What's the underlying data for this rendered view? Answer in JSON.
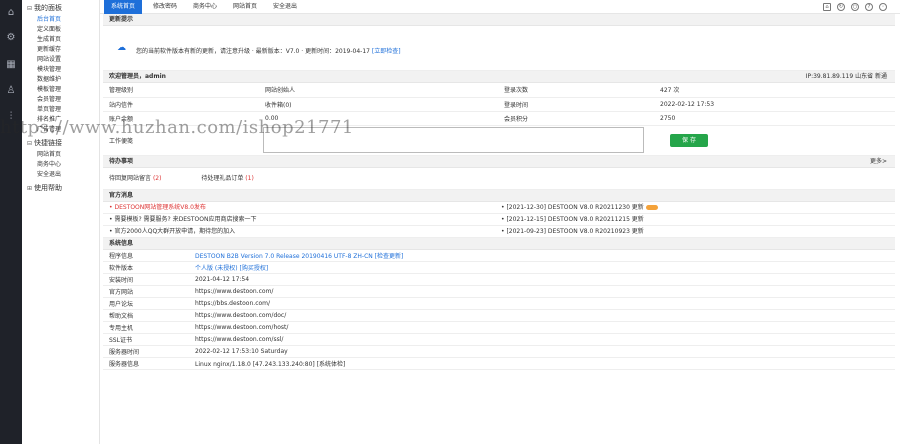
{
  "iconbar": [
    "home-icon",
    "gear-icon",
    "grid-icon",
    "user-icon",
    "chart-icon"
  ],
  "sidebar": {
    "groups": [
      {
        "label": "我的面板",
        "items": [
          "后台首页",
          "定义面板",
          "生成首页",
          "更新缓存",
          "网站设置",
          "模块管理",
          "数据维护",
          "模板管理",
          "会员管理",
          "单页管理",
          "排名推广",
          "广告管理"
        ]
      },
      {
        "label": "快捷链接",
        "items": [
          "网站首页",
          "商务中心",
          "安全退出"
        ]
      },
      {
        "label": "使用帮助",
        "items": []
      }
    ],
    "active_item": "后台首页"
  },
  "topbar": {
    "tabs": [
      "系统首页",
      "修改密码",
      "商务中心",
      "网站首页",
      "安全退出"
    ],
    "tools": [
      "home-icon",
      "refresh-icon",
      "search-icon",
      "help-icon",
      "user-icon"
    ]
  },
  "update": {
    "title": "更新提示",
    "text": "您的当前软件版本有新的更新，请注意升级 · 最新版本：V7.0 · 更新时间：2019-04-17",
    "link": "[立即检查]"
  },
  "welcome": {
    "title": "欢迎管理员，admin",
    "ip": "IP:39.81.89.119 山东省 新通",
    "rows": [
      [
        "管理级别",
        "网站创始人",
        "登录次数",
        "427 次"
      ],
      [
        "站内信件",
        "收件箱(0)",
        "登录时间",
        "2022-02-12 17:53"
      ],
      [
        "账户余额",
        "0.00",
        "会员积分",
        "2750"
      ]
    ],
    "work_label": "工作便笺",
    "save": "保 存"
  },
  "todo": {
    "title": "待办事项",
    "more": "更多>",
    "items": [
      {
        "label": "待回复网站留言",
        "count": "(2)"
      },
      {
        "label": "待处理礼品订单",
        "count": "(1)"
      }
    ]
  },
  "official": {
    "title": "官方消息",
    "left": [
      "• DESTOON网站管理系统V8.0发布",
      "• 需要模板? 需要服务? 来DESTOON应用商店搜索一下",
      "• 官方2000人QQ大群开放申请，期待您的加入"
    ],
    "right": [
      "• [2021-12-30]  DESTOON V8.0 R20211230 更新",
      "• [2021-12-15]  DESTOON V8.0 R20211215 更新",
      "• [2021-09-23]  DESTOON V8.0 R20210923 更新"
    ]
  },
  "sysinfo": {
    "title": "系统信息",
    "rows": [
      [
        "程序信息",
        "DESTOON B2B Version 7.0 Release 20190416 UTF-8 ZH-CN [检查更新]"
      ],
      [
        "软件版本",
        "个人版 (未授权) [购买授权]"
      ],
      [
        "安装时间",
        "2021-04-12 17:54"
      ],
      [
        "官方网站",
        "https://www.destoon.com/"
      ],
      [
        "用户论坛",
        "https://bbs.destoon.com/"
      ],
      [
        "帮助文档",
        "https://www.destoon.com/doc/"
      ],
      [
        "专用主机",
        "https://www.destoon.com/host/"
      ],
      [
        "SSL证书",
        "https://www.destoon.com/ssl/"
      ],
      [
        "服务器时间",
        "2022-02-12 17:53:10 Saturday"
      ],
      [
        "服务器信息",
        "Linux nginx/1.18.0 [47.243.133.240:80] [系统体检]"
      ]
    ]
  },
  "watermark": "https://www.huzhan.com/ishop21771"
}
